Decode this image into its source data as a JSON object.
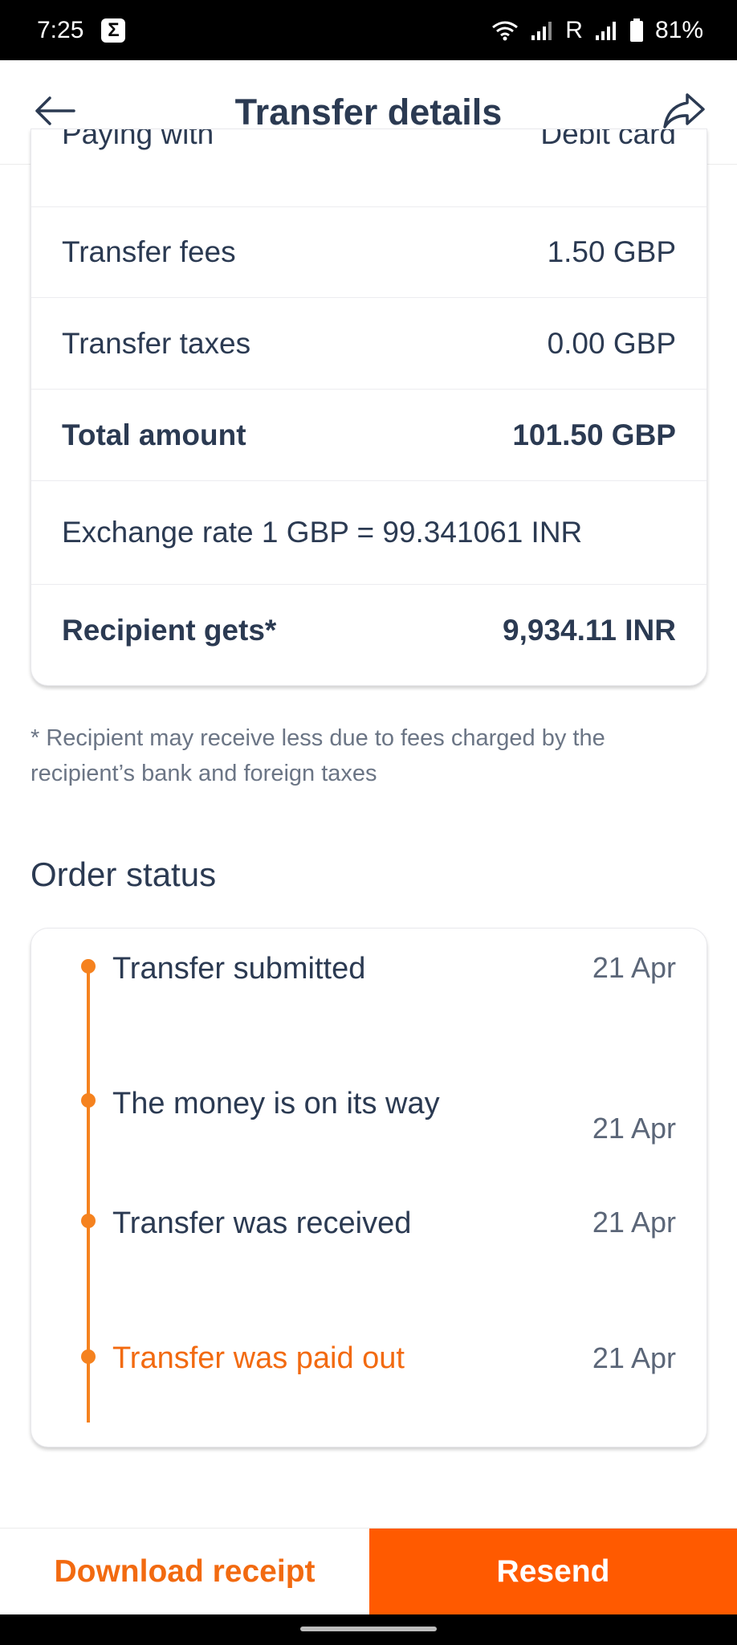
{
  "status_bar": {
    "time": "7:25",
    "sigma_icon": "Σ",
    "roaming": "R",
    "battery": "81%"
  },
  "header": {
    "title": "Transfer details",
    "back_icon": "arrow-left-icon",
    "share_icon": "share-icon"
  },
  "details": {
    "partial_row": {
      "label": "Paying with",
      "value": "Debit card"
    },
    "rows": [
      {
        "label": "Transfer fees",
        "value": "1.50 GBP"
      },
      {
        "label": "Transfer taxes",
        "value": "0.00 GBP"
      },
      {
        "label": "Total amount",
        "value": "101.50 GBP"
      }
    ],
    "exchange_rate": "Exchange rate 1 GBP = 99.341061 INR",
    "recipient_label": "Recipient gets*",
    "recipient_value": "9,934.11 INR"
  },
  "note": "* Recipient may receive less due to fees charged by the recipient’s bank and foreign taxes",
  "order_status": {
    "title": "Order status",
    "steps": [
      {
        "label": "Transfer submitted",
        "date": "21 Apr"
      },
      {
        "label": "The money is on its way",
        "date": "21 Apr"
      },
      {
        "label": "Transfer was received",
        "date": "21 Apr"
      },
      {
        "label": "Transfer was paid out",
        "date": "21 Apr"
      }
    ]
  },
  "actions": {
    "download": "Download receipt",
    "resend": "Resend"
  },
  "colors": {
    "accent": "#ff5a00",
    "timeline": "#f5821f",
    "text": "#2b3a52"
  }
}
